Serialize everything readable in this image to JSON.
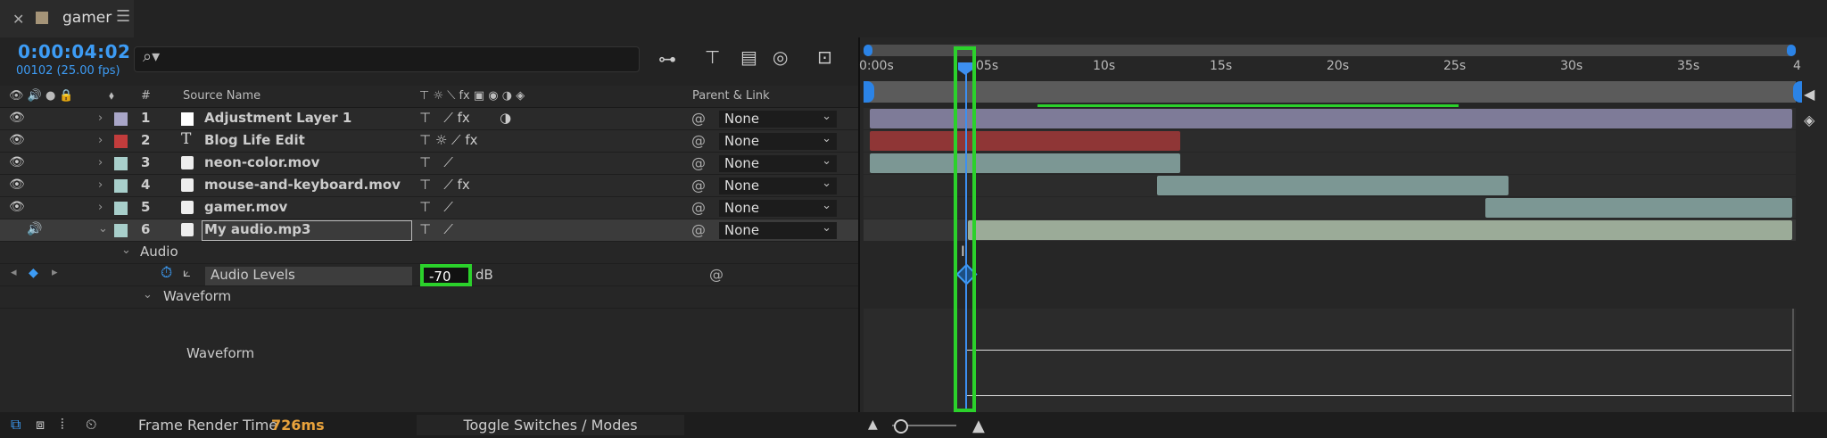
{
  "tab": {
    "name": "gamer"
  },
  "composition": {
    "timecode": "0:00:04:02",
    "frame_info": "00102 (25.00 fps)"
  },
  "columns": {
    "number": "#",
    "source_name": "Source Name",
    "parent_link": "Parent & Link"
  },
  "layers": [
    {
      "num": "1",
      "name": "Adjustment Layer 1",
      "label_color": "#a9a6c8",
      "parent": "None"
    },
    {
      "num": "2",
      "name": "Blog Life Edit",
      "label_color": "#c23c3c",
      "parent": "None"
    },
    {
      "num": "3",
      "name": "neon-color.mov",
      "label_color": "#a8cfcb",
      "parent": "None"
    },
    {
      "num": "4",
      "name": "mouse-and-keyboard.mov",
      "label_color": "#a8cfcb",
      "parent": "None"
    },
    {
      "num": "5",
      "name": "gamer.mov",
      "label_color": "#a8cfcb",
      "parent": "None"
    },
    {
      "num": "6",
      "name": "My audio.mp3",
      "label_color": "#a8cfcb",
      "parent": "None"
    }
  ],
  "audio_group": {
    "label": "Audio",
    "property": "Audio Levels",
    "value": "-70",
    "unit": "dB"
  },
  "waveform_group": {
    "label": "Waveform",
    "sub_label": "Waveform"
  },
  "ruler": {
    "labels": [
      "0:00s",
      "05s",
      "10s",
      "15s",
      "20s",
      "25s",
      "30s",
      "35s",
      "4"
    ]
  },
  "footer": {
    "render_label": "Frame Render Time",
    "render_value": "726ms",
    "toggle_label": "Toggle Switches / Modes"
  },
  "colors": {
    "accent": "#3d9cf5",
    "highlight": "#2bd12b",
    "render_value": "#e8a23c"
  }
}
